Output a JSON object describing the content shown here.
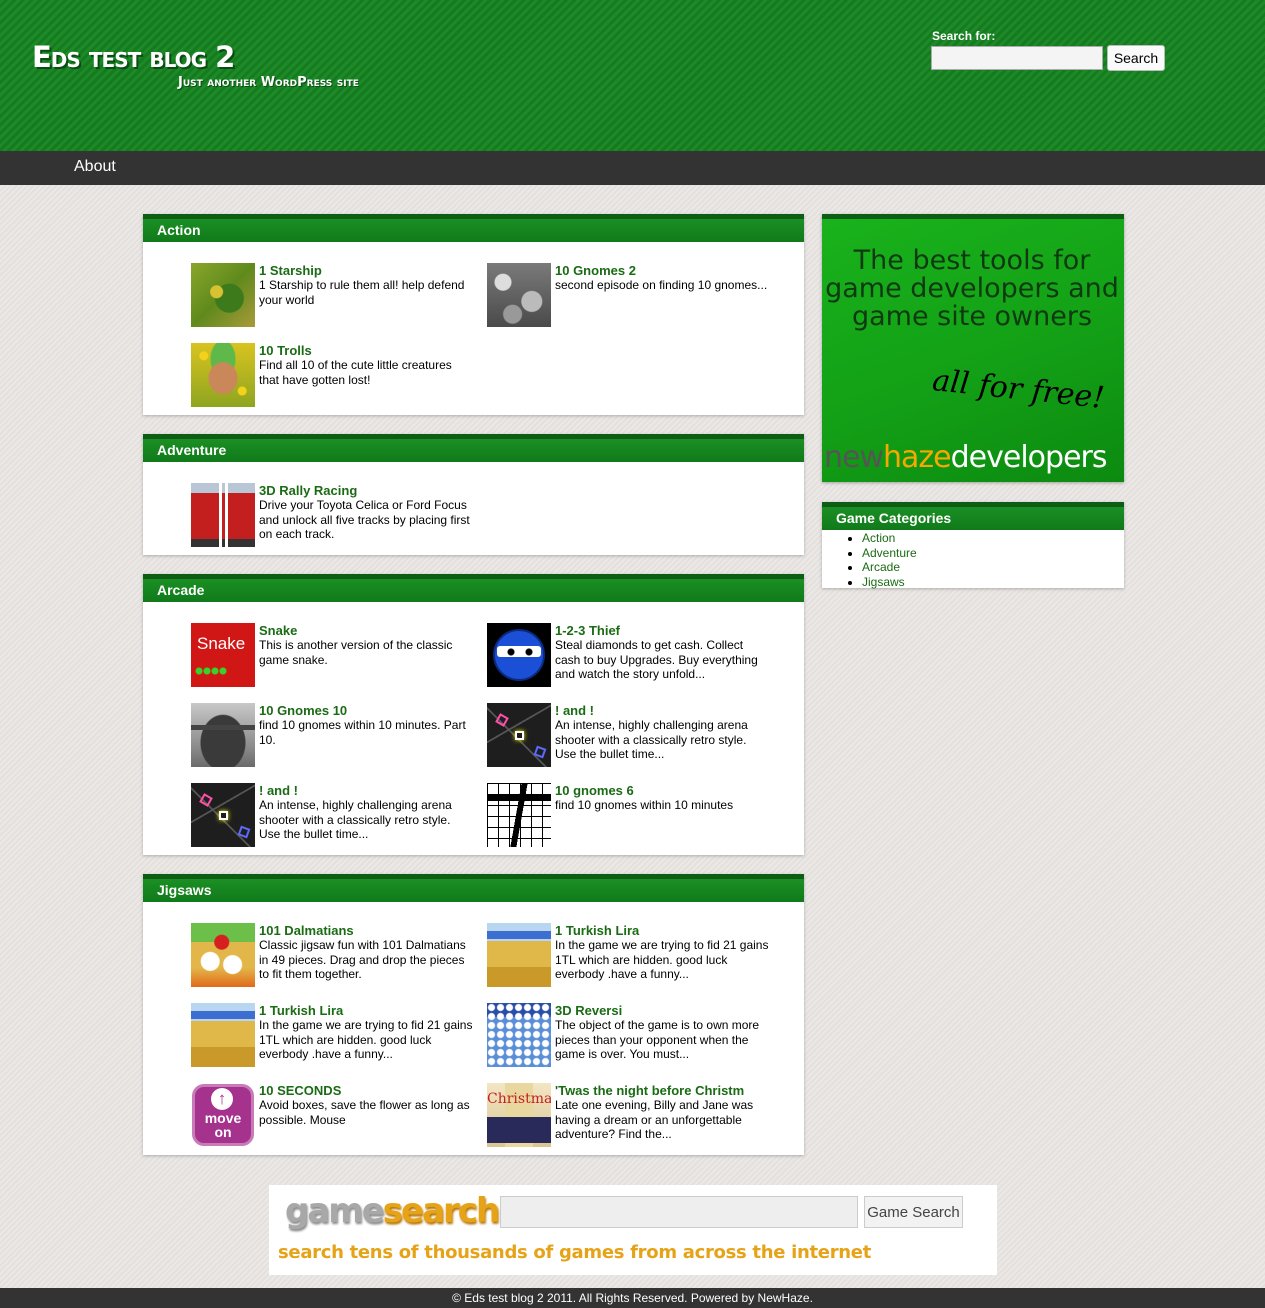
{
  "header": {
    "site_title": "Eds test blog 2",
    "tagline": "Just another WordPress site",
    "search_label": "Search for:",
    "search_value": "",
    "search_button": "Search"
  },
  "nav": {
    "about": "About"
  },
  "sections": [
    {
      "title": "Action",
      "games": [
        {
          "title": "1 Starship",
          "desc": "1 Starship to rule them all! help defend your world",
          "thumb": "starship"
        },
        {
          "title": "10 Gnomes 2",
          "desc": "second episode on finding 10 gnomes...",
          "thumb": "rocks"
        },
        {
          "title": "10 Trolls",
          "desc": "Find all 10 of the cute little creatures that have gotten lost!",
          "thumb": "troll"
        }
      ]
    },
    {
      "title": "Adventure",
      "games": [
        {
          "title": "3D Rally Racing",
          "desc": "Drive your Toyota Celica or Ford Focus and unlock all five tracks by placing first on each track.",
          "thumb": "rally"
        }
      ]
    },
    {
      "title": "Arcade",
      "games": [
        {
          "title": "Snake",
          "desc": "This is another version of the classic game snake.",
          "thumb": "snake",
          "thumb_text": "Snake"
        },
        {
          "title": "1-2-3 Thief",
          "desc": "Steal diamonds to get cash. Collect cash to buy Upgrades. Buy everything and watch the story unfold...",
          "thumb": "thief"
        },
        {
          "title": "10 Gnomes 10",
          "desc": "find 10 gnomes within 10 minutes. Part 10.",
          "thumb": "boat"
        },
        {
          "title": "! and !",
          "desc": "An intense, highly challenging arena shooter with a classically retro style. Use the bullet time...",
          "thumb": "arena"
        },
        {
          "title": "! and !",
          "desc": "An intense, highly challenging arena shooter with a classically retro style. Use the bullet time...",
          "thumb": "arena"
        },
        {
          "title": "10 gnomes 6",
          "desc": "find 10 gnomes within 10 minutes",
          "thumb": "grid"
        }
      ]
    },
    {
      "title": "Jigsaws",
      "games": [
        {
          "title": "101 Dalmatians",
          "desc": "Classic jigsaw fun with 101 Dalmatians in 49 pieces. Drag and drop the pieces to fit them together.",
          "thumb": "dalmatians"
        },
        {
          "title": "1 Turkish Lira",
          "desc": "In the game we are trying to fid 21 gains 1TL which are hidden. good luck everbody .have a funny...",
          "thumb": "lira"
        },
        {
          "title": "1 Turkish Lira",
          "desc": "In the game we are trying to fid 21 gains 1TL which are hidden. good luck everbody .have a funny...",
          "thumb": "lira"
        },
        {
          "title": "3D Reversi",
          "desc": "The object of the game is to own more pieces than your opponent when the game is over. You must...",
          "thumb": "reversi"
        },
        {
          "title": "10 SECONDS",
          "desc": "Avoid boxes, save the flower as long as possible. Mouse",
          "thumb": "moveon",
          "thumb_text": "move on"
        },
        {
          "title": "'Twas the night before Christm",
          "desc": "Late one evening, Billy and Jane was having a dream or an unforgettable adventure? Find the...",
          "thumb": "christmas",
          "thumb_text": "Christmas"
        }
      ]
    }
  ],
  "sidebar": {
    "ad": {
      "headline": "The best tools for game developers and game site owners",
      "tagline": "all for free!",
      "brand_new": "new",
      "brand_haze": "haze",
      "brand_dev": "developers"
    },
    "categories_title": "Game Categories",
    "categories": [
      "Action",
      "Adventure",
      "Arcade",
      "Jigsaws"
    ]
  },
  "gamesearch": {
    "logo_game": "game",
    "logo_search": "search",
    "input_value": "",
    "button": "Game Search",
    "tagline": "search tens of thousands of games from across the internet"
  },
  "footer": {
    "text": "© Eds test blog 2 2011. All Rights Reserved. Powered by NewHaze."
  },
  "colors": {
    "header_green": "#1d8a28",
    "link_green": "#1a6b14",
    "nav_dark": "#333333",
    "gamesearch_orange": "#e6a317"
  }
}
